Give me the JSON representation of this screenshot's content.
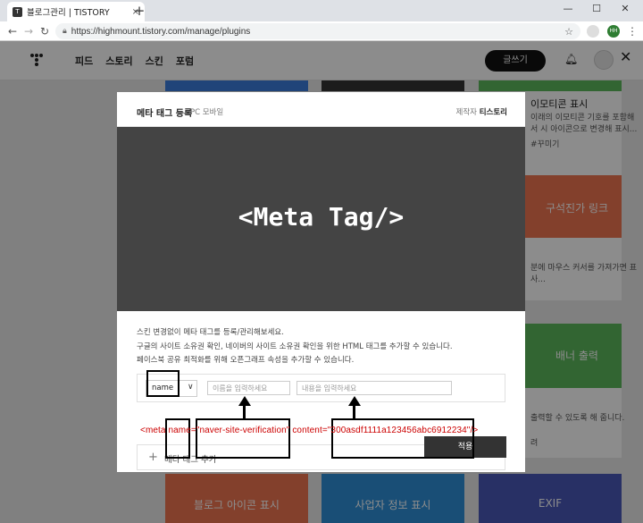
{
  "browser": {
    "tab_title": "블로그관리 | TISTORY",
    "tab_favicon": "T",
    "new_tab": "+",
    "tab_close": "×",
    "url": "https://highmount.tistory.com/manage/plugins",
    "profile_initials": "HH",
    "window_controls": [
      "—",
      "☐",
      "✕"
    ]
  },
  "tistory": {
    "menu": [
      "피드",
      "스토리",
      "스킨",
      "포럼"
    ],
    "write_button": "글쓰기",
    "close_symbol": "✕"
  },
  "background_cards": {
    "emoticon": {
      "title": "이모티콘 표시",
      "desc": [
        "이래의 이모티콘 기호를 포함해",
        "서 시 아이콘으로 변경해 표시..."
      ],
      "tag": "#꾸미기"
    },
    "corner_link": {
      "thumb": "구석진가 링크",
      "desc": [
        "분에 마우스 커서를 가져가면 표",
        "사..."
      ]
    },
    "banner_output": {
      "thumb": "배너 출력",
      "desc": [
        "출력할 수 있도록 해 줍니다."
      ],
      "tag": "려"
    },
    "bottom": [
      "블로그 아이콘 표시",
      "사업자 정보 표시",
      "EXIF"
    ]
  },
  "modal": {
    "title": "메타 태그 등록",
    "subtitle": "PC 모바일",
    "maker_label": "제작자",
    "maker": "티스토리",
    "banner_text": "<Meta Tag/>",
    "description": [
      "스킨 변경없이 메타 태그를 등록/관리해보세요.",
      "구글의 사이트 소유권 확인, 네이버의 사이트 소유권 확인을 위한 HTML 태그를 추가할 수 있습니다.",
      "페이스북 공유 최적화를 위해 오픈그래프 속성을 추가할 수 있습니다."
    ],
    "select_value": "name",
    "select_arrow": "∨",
    "name_placeholder": "이름을 입력하세요",
    "content_placeholder": "내용을 입력하세요",
    "add_plus": "+",
    "add_label": "메타 태그 추가",
    "apply_button": "적용"
  },
  "annotation": {
    "meta_example": "<meta name=\"naver-site-verification\" content=\"300asdf1111a123456abc6912234\"/>"
  }
}
